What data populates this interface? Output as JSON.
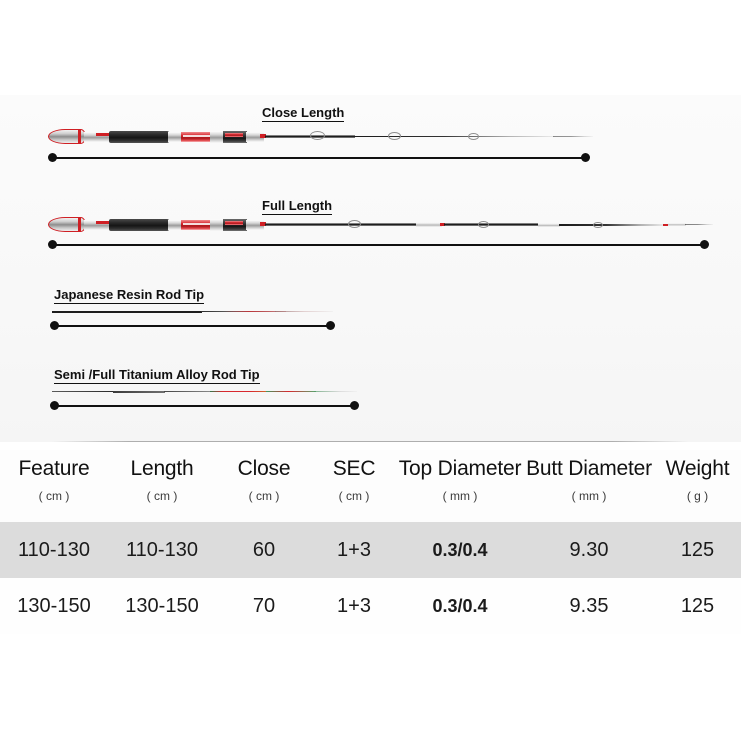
{
  "diagram": {
    "sections": [
      {
        "label": "Close Length",
        "name": "close-length"
      },
      {
        "label": "Full Length",
        "name": "full-length"
      },
      {
        "label": "Japanese Resin Rod Tip",
        "name": "japanese-resin-rod-tip"
      },
      {
        "label": "Semi /Full Titanium Alloy Rod Tip",
        "name": "semi-full-titanium-alloy-rod-tip"
      }
    ]
  },
  "colors": {
    "accent_red": "#cf1f24",
    "row_highlight": "#dcdcdc",
    "line": "#111111"
  },
  "table": {
    "headers": [
      {
        "title": "Feature",
        "unit": "( cm )"
      },
      {
        "title": "Length",
        "unit": "( cm )"
      },
      {
        "title": "Close",
        "unit": "( cm )"
      },
      {
        "title": "SEC",
        "unit": "( cm )"
      },
      {
        "title": "Top Diameter",
        "unit": "( mm )"
      },
      {
        "title": "Butt Diameter",
        "unit": "( mm )"
      },
      {
        "title": "Weight",
        "unit": "( g )"
      }
    ],
    "rows": [
      {
        "feature": "110-130",
        "length": "110-130",
        "close": "60",
        "sec": "1+3",
        "top_diameter": "0.3/0.4",
        "butt_diameter": "9.30",
        "weight": "125"
      },
      {
        "feature": "130-150",
        "length": "130-150",
        "close": "70",
        "sec": "1+3",
        "top_diameter": "0.3/0.4",
        "butt_diameter": "9.35",
        "weight": "125"
      }
    ]
  }
}
